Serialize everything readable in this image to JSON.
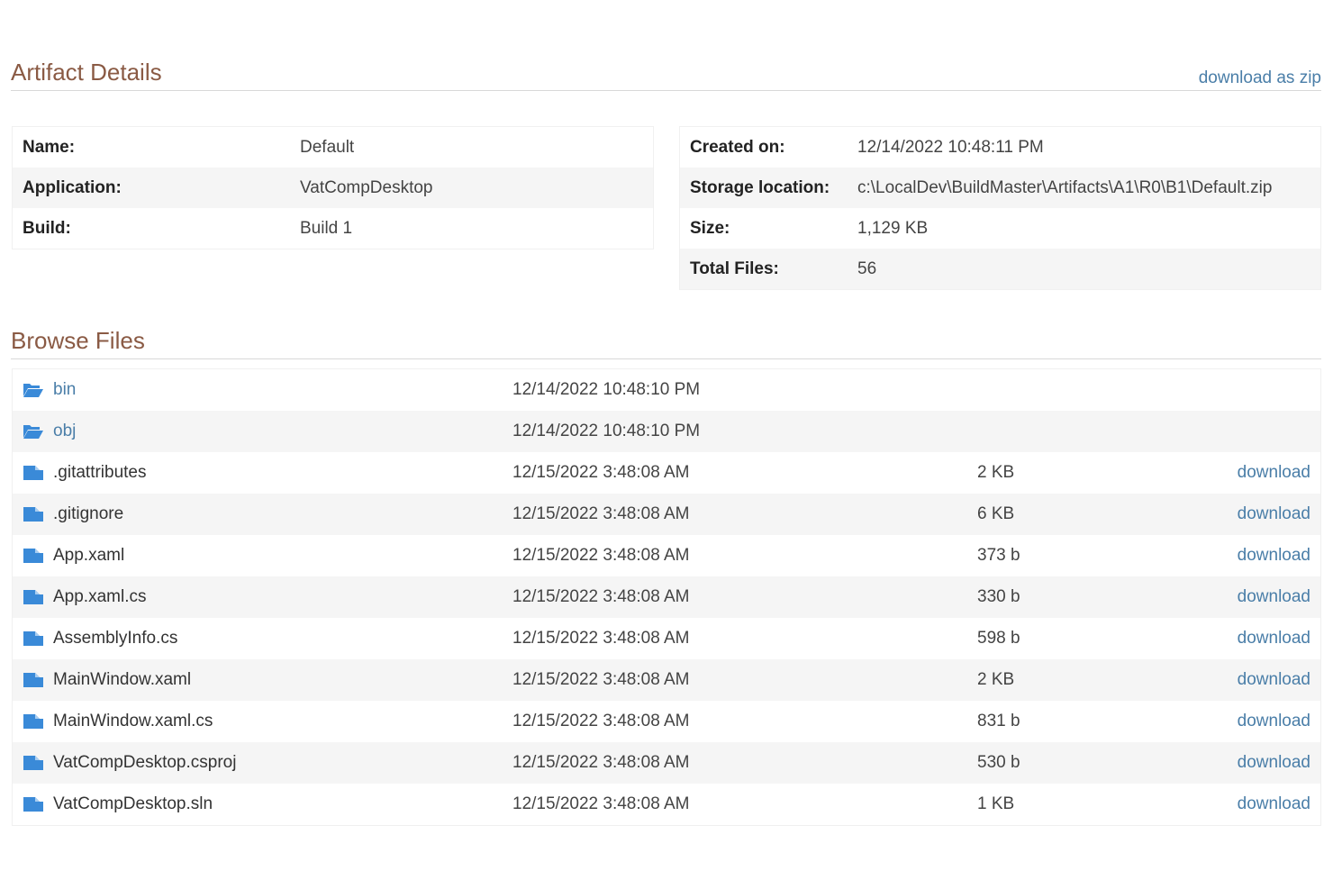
{
  "artifact_section": {
    "title": "Artifact Details",
    "download_zip_label": "download as zip"
  },
  "details_left": [
    {
      "label": "Name:",
      "value": "Default"
    },
    {
      "label": "Application:",
      "value": "VatCompDesktop"
    },
    {
      "label": "Build:",
      "value": "Build 1"
    }
  ],
  "details_right": [
    {
      "label": "Created on:",
      "value": "12/14/2022 10:48:11 PM"
    },
    {
      "label": "Storage location:",
      "value": "c:\\LocalDev\\BuildMaster\\Artifacts\\A1\\R0\\B1\\Default.zip"
    },
    {
      "label": "Size:",
      "value": "1,129 KB"
    },
    {
      "label": "Total Files:",
      "value": "56"
    }
  ],
  "browse_section": {
    "title": "Browse Files"
  },
  "files": [
    {
      "type": "folder",
      "name": "bin",
      "date": "12/14/2022 10:48:10 PM",
      "size": "",
      "download": ""
    },
    {
      "type": "folder",
      "name": "obj",
      "date": "12/14/2022 10:48:10 PM",
      "size": "",
      "download": ""
    },
    {
      "type": "file",
      "name": ".gitattributes",
      "date": "12/15/2022 3:48:08 AM",
      "size": "2 KB",
      "download": "download"
    },
    {
      "type": "file",
      "name": ".gitignore",
      "date": "12/15/2022 3:48:08 AM",
      "size": "6 KB",
      "download": "download"
    },
    {
      "type": "file",
      "name": "App.xaml",
      "date": "12/15/2022 3:48:08 AM",
      "size": "373 b",
      "download": "download"
    },
    {
      "type": "file",
      "name": "App.xaml.cs",
      "date": "12/15/2022 3:48:08 AM",
      "size": "330 b",
      "download": "download"
    },
    {
      "type": "file",
      "name": "AssemblyInfo.cs",
      "date": "12/15/2022 3:48:08 AM",
      "size": "598 b",
      "download": "download"
    },
    {
      "type": "file",
      "name": "MainWindow.xaml",
      "date": "12/15/2022 3:48:08 AM",
      "size": "2 KB",
      "download": "download"
    },
    {
      "type": "file",
      "name": "MainWindow.xaml.cs",
      "date": "12/15/2022 3:48:08 AM",
      "size": "831 b",
      "download": "download"
    },
    {
      "type": "file",
      "name": "VatCompDesktop.csproj",
      "date": "12/15/2022 3:48:08 AM",
      "size": "530 b",
      "download": "download"
    },
    {
      "type": "file",
      "name": "VatCompDesktop.sln",
      "date": "12/15/2022 3:48:08 AM",
      "size": "1 KB",
      "download": "download"
    }
  ],
  "icons": {
    "folder": "folder-open-icon",
    "file": "file-icon"
  },
  "colors": {
    "heading": "#8a5a44",
    "link": "#4a7ea8",
    "icon": "#3a8ad8"
  }
}
